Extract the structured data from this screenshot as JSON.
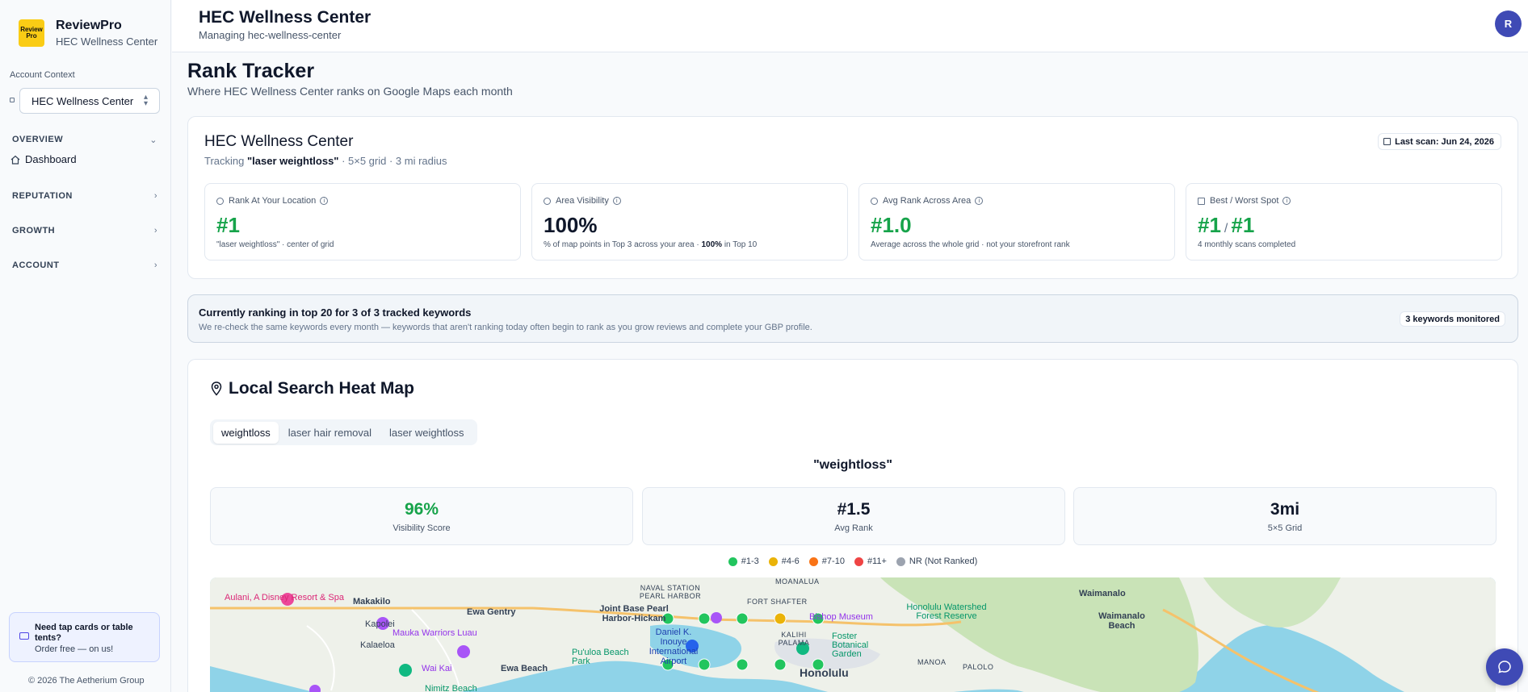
{
  "sidebar": {
    "brand_name": "ReviewPro",
    "brand_sub": "HEC Wellness Center",
    "logo_text": "Review Pro",
    "account_context_label": "Account Context",
    "account_selected": "HEC Wellness Center",
    "sections": [
      {
        "label": "OVERVIEW",
        "expanded": true
      },
      {
        "label": "REPUTATION",
        "expanded": false
      },
      {
        "label": "GROWTH",
        "expanded": false
      },
      {
        "label": "ACCOUNT",
        "expanded": false
      }
    ],
    "dashboard_label": "Dashboard",
    "promo_title": "Need tap cards or table tents?",
    "promo_sub": "Order free — on us!",
    "copyright": "© 2026 The Aetherium Group"
  },
  "header": {
    "title": "HEC Wellness Center",
    "subtitle": "Managing hec-wellness-center",
    "avatar_initial": "R"
  },
  "page": {
    "title": "Rank Tracker",
    "subtitle": "Where HEC Wellness Center ranks on Google Maps each month"
  },
  "summary": {
    "business": "HEC Wellness Center",
    "tracking_prefix": "Tracking ",
    "tracking_keyword": "\"laser weightloss\"",
    "tracking_suffix": " · 5×5 grid · 3 mi radius",
    "last_scan": "Last scan: Jun 24, 2026",
    "metrics": [
      {
        "label": "Rank At Your Location",
        "value": "#1",
        "desc": "\"laser weightloss\" · center of grid"
      },
      {
        "label": "Area Visibility",
        "value": "100%",
        "desc_prefix": "% of map points in Top 3 across your area · ",
        "desc_bold": "100%",
        "desc_suffix": " in Top 10"
      },
      {
        "label": "Avg Rank Across Area",
        "value": "#1.0",
        "desc": "Average across the whole grid · not your storefront rank"
      },
      {
        "label": "Best / Worst Spot",
        "best": "#1",
        "slash": "/",
        "worst": "#1",
        "desc": "4 monthly scans completed"
      }
    ]
  },
  "notice": {
    "title": "Currently ranking in top 20 for 3 of 3 tracked keywords",
    "subtitle": "We re-check the same keywords every month — keywords that aren't ranking today often begin to rank as you grow reviews and complete your GBP profile.",
    "badge": "3 keywords monitored"
  },
  "heatmap": {
    "title": "Local Search Heat Map",
    "tabs": [
      "weightloss",
      "laser hair removal",
      "laser weightloss"
    ],
    "active_tab": 0,
    "keyword_title": "\"weightloss\"",
    "stats": [
      {
        "value": "96%",
        "label": "Visibility Score"
      },
      {
        "value": "#1.5",
        "label": "Avg Rank"
      },
      {
        "value": "3mi",
        "label": "5×5 Grid"
      }
    ],
    "legend": [
      {
        "label": "#1-3",
        "color": "#22c55e"
      },
      {
        "label": "#4-6",
        "color": "#eab308"
      },
      {
        "label": "#7-10",
        "color": "#f97316"
      },
      {
        "label": "#11+",
        "color": "#ef4444"
      },
      {
        "label": "NR (Not Ranked)",
        "color": "#9ca3af"
      }
    ],
    "map_labels": {
      "aulani": "Aulani, A Disney Resort & Spa",
      "makakilo": "Makakilo",
      "kapolei": "Kapolei",
      "kalaeloa": "Kalaeloa",
      "ewa_gentry": "Ewa Gentry",
      "mauka": "Mauka Warriors Luau",
      "wai_kai": "Wai Kai",
      "ewa_beach": "Ewa Beach",
      "puuloa": "Pu'uloa Beach Park",
      "nimitz": "Nimitz Beach",
      "naval": "NAVAL STATION PEARL HARBOR",
      "jbphh": "Joint Base Pearl Harbor-Hickam",
      "airport": "Daniel K. Inouye International Airport",
      "fort_shafter": "FORT SHAFTER",
      "kalihi": "KALIHI PALAMA",
      "bishop": "Bishop Museum",
      "foster": "Foster Botanical Garden",
      "honolulu": "Honolulu",
      "watershed": "Honolulu Watershed Forest Reserve",
      "manoa": "MANOA",
      "palolo": "PALOLO",
      "waimanalo": "Waimanalo",
      "waimanalo_beach": "Waimanalo Beach",
      "moanalua": "MOANALUA"
    },
    "grid_points": [
      {
        "rank": 1
      },
      {
        "rank": 1
      },
      {
        "rank": 1
      },
      {
        "rank": 5
      },
      {
        "rank": 1
      },
      {
        "rank": 1
      },
      {
        "rank": 1
      },
      {
        "rank": 1
      },
      {
        "rank": 1
      },
      {
        "rank": 1
      }
    ]
  }
}
